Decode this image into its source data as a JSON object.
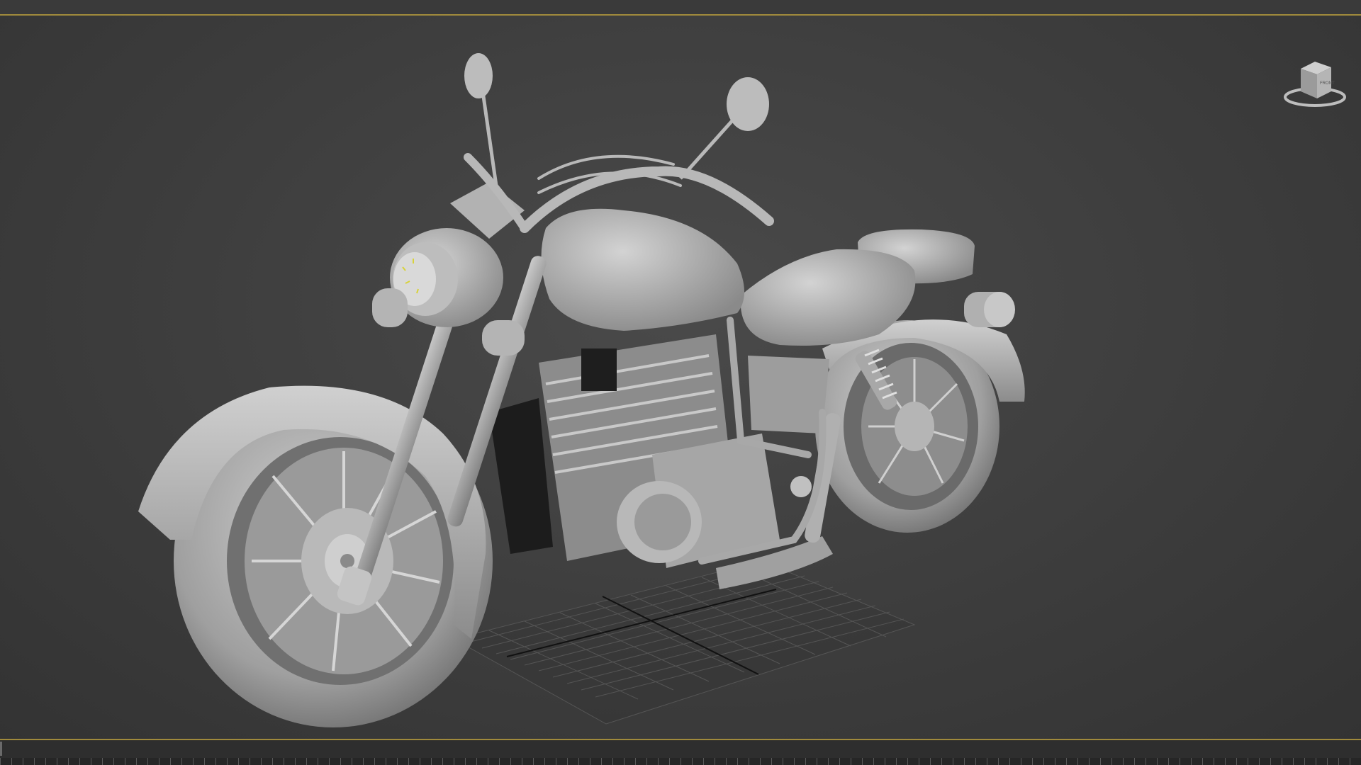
{
  "viewport": {
    "view_cube_label": "FRONT"
  },
  "scene": {
    "object": "motorcycle-model",
    "shading": "clay-gray",
    "grid": true
  },
  "colors": {
    "background": "#3d3d3d",
    "viewport_border": "#a08a3c",
    "model": "#b8b8b8",
    "grid": "#5a5a5a",
    "highlight": "#d8d23a"
  },
  "icons": {
    "view_cube": "view-cube-icon"
  }
}
